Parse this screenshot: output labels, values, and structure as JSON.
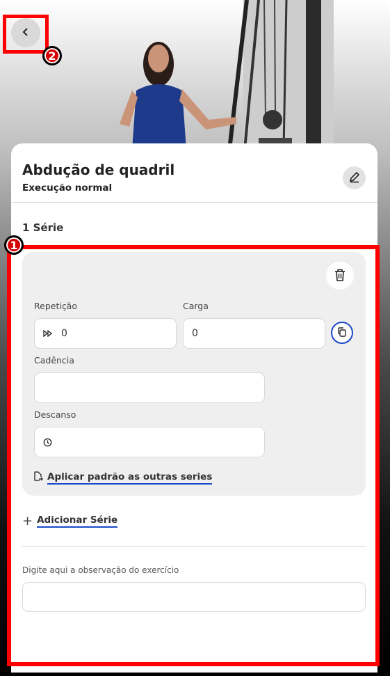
{
  "annotations": {
    "marker1": "1",
    "marker2": "2"
  },
  "header": {
    "back_icon": "chevron-left-icon"
  },
  "exercise": {
    "title": "Abdução de quadril",
    "subtitle": "Execução normal",
    "edit_icon": "pencil-icon"
  },
  "series_title": "1 Série",
  "set_card": {
    "repeticao_label": "Repetição",
    "repeticao_value": "0",
    "carga_label": "Carga",
    "carga_value": "0",
    "cadencia_label": "Cadência",
    "cadencia_value": "",
    "descanso_label": "Descanso",
    "descanso_value": "",
    "apply_label": "Aplicar padrão as outras series"
  },
  "add_series_label": "Adicionar Série",
  "observation": {
    "label": "Digite aqui a observação do exercício",
    "value": ""
  },
  "colors": {
    "accent": "#1a48c8",
    "annotation": "#ff0000"
  }
}
